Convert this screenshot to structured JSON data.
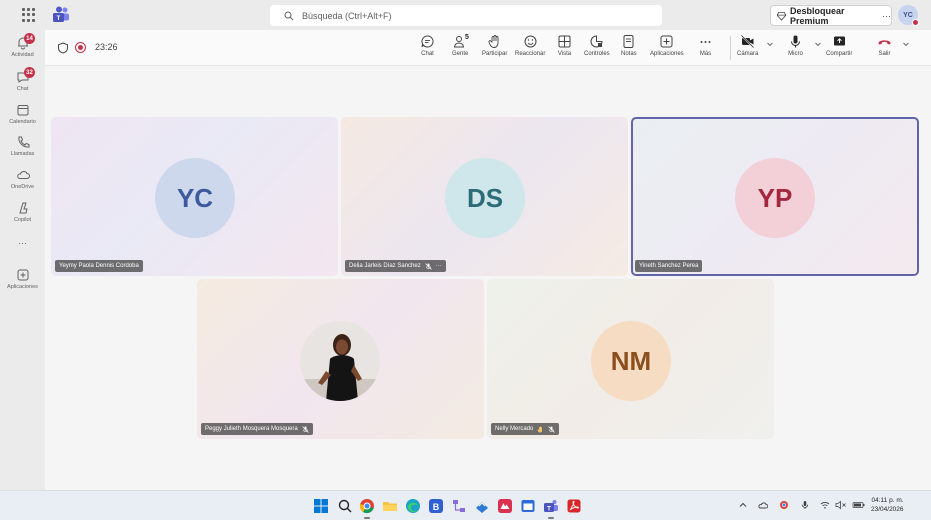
{
  "titlebar": {
    "search_placeholder": "Búsqueda (Ctrl+Alt+F)",
    "premium_label": "Desbloquear Premium",
    "more_label": "···",
    "user_initials": "YC"
  },
  "rail": {
    "items": [
      {
        "label": "Actividad",
        "badge": "14"
      },
      {
        "label": "Chat",
        "badge": "32"
      },
      {
        "label": "Calendario"
      },
      {
        "label": "Llamadas"
      },
      {
        "label": "OneDrive"
      },
      {
        "label": "Copilot"
      },
      {
        "label": "···"
      },
      {
        "label": "Aplicaciones"
      }
    ]
  },
  "toolbar": {
    "timer": "23:26",
    "people_count": "5",
    "buttons": {
      "chat": "Chat",
      "people": "Gente",
      "raise": "Participar",
      "react": "Reaccionar",
      "view": "Vista",
      "controls": "Controles",
      "notes": "Notas",
      "apps": "Aplicaciones",
      "more": "Más",
      "camera": "Cámara",
      "mic": "Micro",
      "share": "Compartir",
      "leave": "Salir"
    }
  },
  "participants": [
    {
      "initials": "YC",
      "name": "Yeymy Paola Dennis Cordoba",
      "color": "#3d5a9e",
      "circle": "#cdd8ec"
    },
    {
      "initials": "DS",
      "name": "Delia Jarleis Díaz Sanchez",
      "color": "#2c6c79",
      "circle": "#cfe6ea",
      "muted": true,
      "more": "···"
    },
    {
      "initials": "YP",
      "name": "Yineth Sanchez Perea",
      "color": "#a3283f",
      "circle": "#f3cfd8",
      "active": true
    },
    {
      "initials": "",
      "name": "Peggy Julieth Mosquera Mosquera",
      "photo": true,
      "muted": true
    },
    {
      "initials": "NM",
      "name": "Nelly Mercado",
      "color": "#8a4f1c",
      "circle": "#f6dcc2",
      "hand": true,
      "muted": true
    }
  ],
  "taskbar": {
    "time": "04:11 p. m.",
    "date": "23/04/2026"
  }
}
